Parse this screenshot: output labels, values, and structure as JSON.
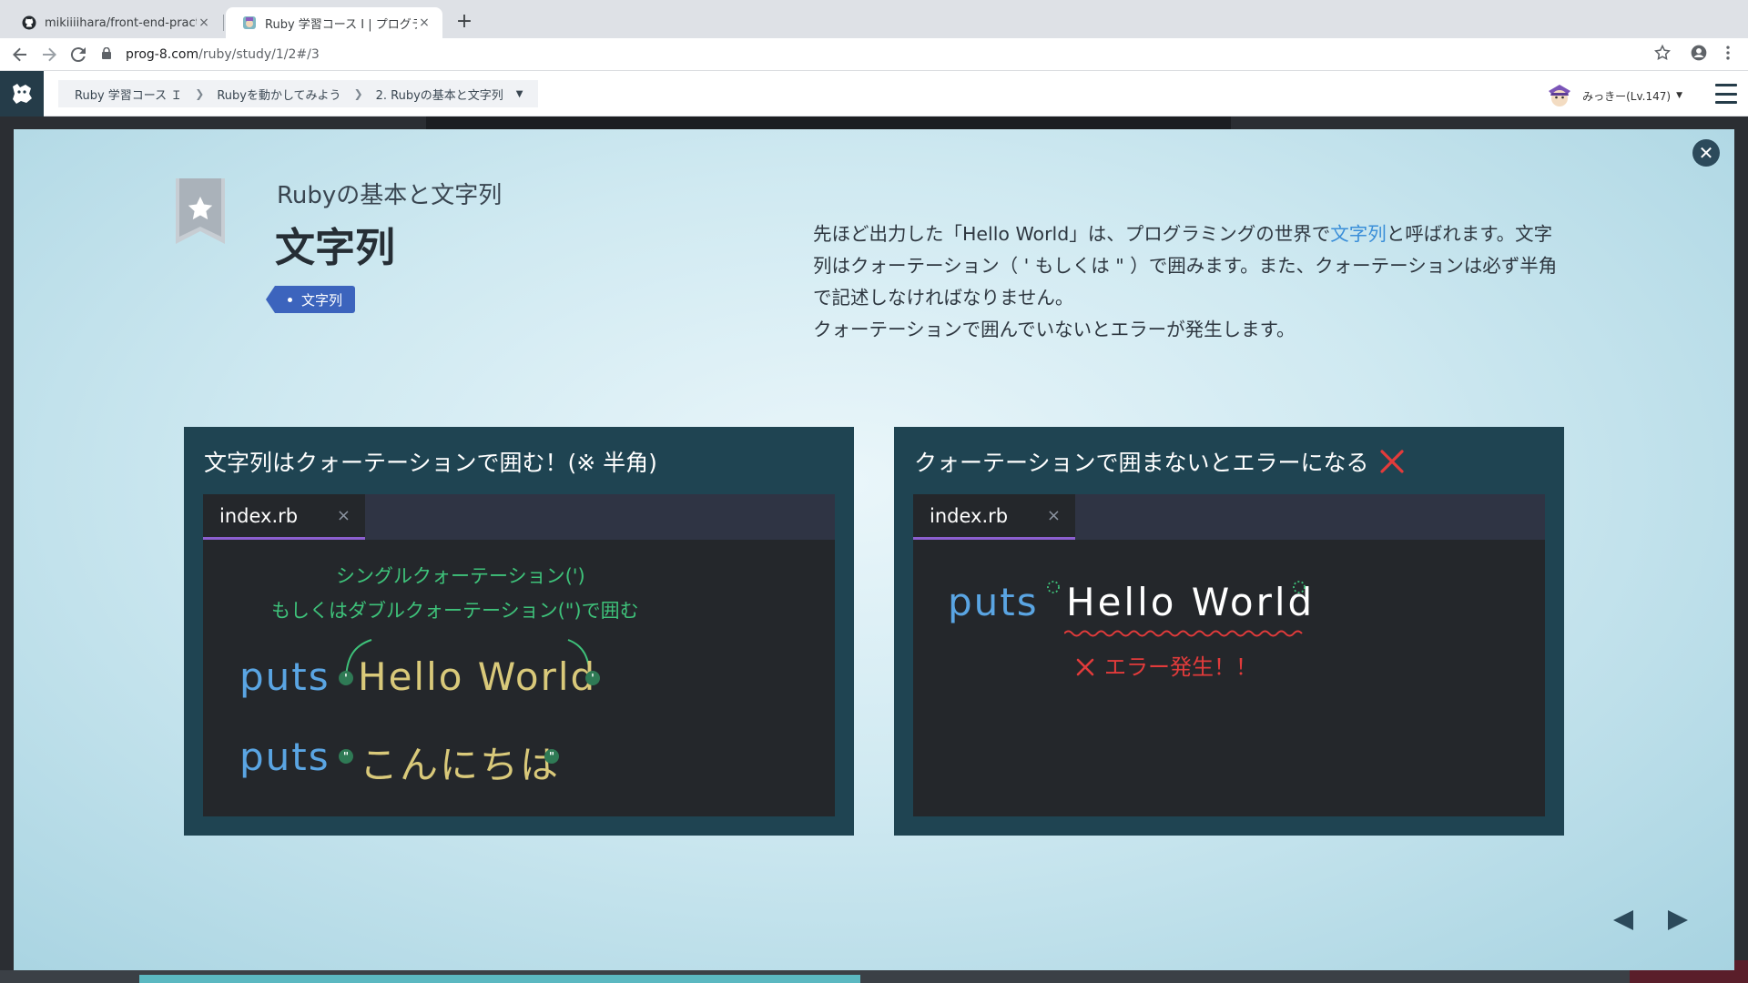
{
  "browser": {
    "tabs": [
      {
        "title": "mikiiiihara/front-end-practice",
        "close": "×"
      },
      {
        "title": "Ruby 学習コース I | プログラミン",
        "close": "×"
      }
    ],
    "new_tab": "+",
    "url_host": "prog-8.com",
    "url_path": "/ruby/study/1/2#/3",
    "icons": [
      "back-icon",
      "forward-icon",
      "reload-icon",
      "lock-icon",
      "star-icon",
      "profile-icon",
      "kebab-menu-icon"
    ]
  },
  "header": {
    "breadcrumb": [
      "Ruby 学習コース Ｉ",
      "Rubyを動かしてみよう",
      "2. Rubyの基本と文字列"
    ],
    "user": "みっきー(Lv.147)"
  },
  "slide": {
    "subtitle": "Rubyの基本と文字列",
    "title": "文字列",
    "tag": "文字列",
    "description": {
      "p1_before": "先ほど出力した「Hello World」は、プログラミングの世界で",
      "p1_highlight": "文字列",
      "p1_after": "と呼ばれます。文字列はクォーテーション（ ' もしくは \" ）で囲みます。また、クォーテーションは必ず半角で記述しなければなりません。",
      "p2": "クォーテーションで囲んでいないとエラーが発生します。"
    },
    "accent_color": "#3a8ed8"
  },
  "panels": {
    "left": {
      "title": "文字列はクォーテーションで囲む！(※ 半角)",
      "file_name": "index.rb",
      "file_close": "×",
      "annotation_line1": "シングルクォーテーション(')",
      "annotation_line2": "もしくはダブルクォーテーション(\")で囲む",
      "code": [
        {
          "keyword": "puts",
          "string": "Hello World",
          "quote": "'"
        },
        {
          "keyword": "puts",
          "string": "こんにちは",
          "quote": "\""
        }
      ]
    },
    "right": {
      "title": "クォーテーションで囲まないとエラーになる",
      "file_name": "index.rb",
      "file_close": "×",
      "code_keyword": "puts",
      "code_string": "Hello World",
      "error": "エラー発生！！"
    }
  }
}
